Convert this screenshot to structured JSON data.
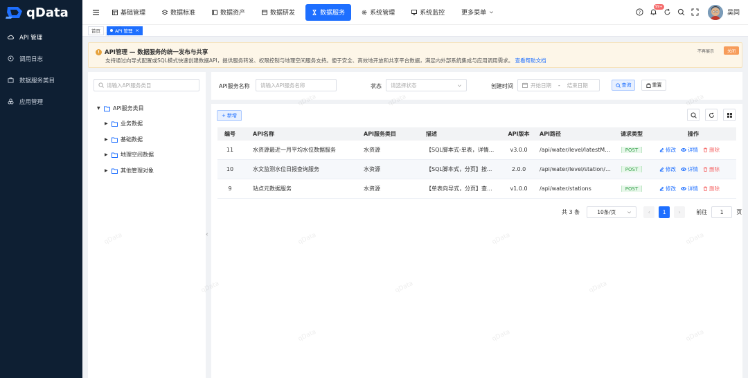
{
  "app": {
    "logo_text": "qData"
  },
  "sidebar": {
    "items": [
      {
        "label": "API 管理",
        "icon": "cloud-icon",
        "active": true
      },
      {
        "label": "调用日志",
        "icon": "log-icon",
        "active": false
      },
      {
        "label": "数据服务类目",
        "icon": "briefcase-icon",
        "active": false
      },
      {
        "label": "应用管理",
        "icon": "apps-icon",
        "active": false
      }
    ]
  },
  "topnav": {
    "items": [
      {
        "label": "基础管理",
        "icon": "grid-icon"
      },
      {
        "label": "数据标准",
        "icon": "layers-icon"
      },
      {
        "label": "数据资产",
        "icon": "asset-icon"
      },
      {
        "label": "数据研发",
        "icon": "dev-icon"
      },
      {
        "label": "数据服务",
        "icon": "hourglass-icon",
        "active": true
      },
      {
        "label": "系统管理",
        "icon": "gear-icon"
      },
      {
        "label": "系统监控",
        "icon": "monitor-icon"
      },
      {
        "label": "更多菜单",
        "icon": "chevron-down-icon"
      }
    ],
    "notification_count": "99+",
    "user_name": "吴同"
  },
  "tabs": [
    {
      "label": "首页",
      "active": false
    },
    {
      "label": "API 管理",
      "active": true
    }
  ],
  "notice": {
    "title": "API管理 — 数据服务的统一发布与共享",
    "description": "支持通过向导式配置或SQL模式快速创建数据API，提供服务转发、权限控制与地理空间服务支持。便于安全、高效地开放和共享平台数据，满足内外部系统集成与应用调用需求。",
    "link": "查看帮助文档",
    "dismiss": "不再展示",
    "close": "关闭"
  },
  "tree": {
    "search_placeholder": "请输入API服务类目",
    "root": "API服务类目",
    "children": [
      "业务数据",
      "基础数据",
      "地理空间数据",
      "其他管理对象"
    ]
  },
  "filter": {
    "name_label": "API服务名称",
    "name_placeholder": "请输入API服务名称",
    "status_label": "状态",
    "status_placeholder": "请选择状态",
    "time_label": "创建时间",
    "start_placeholder": "开始日期",
    "range_sep": "-",
    "end_placeholder": "结束日期",
    "search_button": "查询",
    "reset_button": "重置"
  },
  "toolbar": {
    "add_button": "+ 新增"
  },
  "table": {
    "headers": [
      "编号",
      "API名称",
      "API服务类目",
      "描述",
      "API版本",
      "API路径",
      "请求类型",
      "操作"
    ],
    "rows": [
      {
        "id": "11",
        "name": "水资源最近一月平均水位数据服务",
        "category": "水资源",
        "desc": "【SQL脚本式-单表，详情...",
        "version": "v3.0.0",
        "path": "/api/water/level/latestMo...",
        "method": "POST"
      },
      {
        "id": "10",
        "name": "水文监测水位日报查询服务",
        "category": "水资源",
        "desc": "【SQL脚本式，分页】按...",
        "version": "2.0.0",
        "path": "/api/water/level/station/d...",
        "method": "POST"
      },
      {
        "id": "9",
        "name": "站点元数据服务",
        "category": "水资源",
        "desc": "【单表向导式，分页】查...",
        "version": "v1.0.0",
        "path": "/api/water/stations",
        "method": "POST"
      }
    ],
    "actions": {
      "edit": "修改",
      "detail": "详情",
      "delete": "删除"
    }
  },
  "pagination": {
    "total": "共 3 条",
    "page_size": "10条/页",
    "current_page": "1",
    "goto_label": "前往",
    "goto_value": "1",
    "page_suffix": "页"
  },
  "watermark": "qData",
  "colors": {
    "primary": "#1e6fff",
    "sidebar_bg": "#0e1f33",
    "danger": "#f56c6c",
    "success": "#35a14b"
  }
}
